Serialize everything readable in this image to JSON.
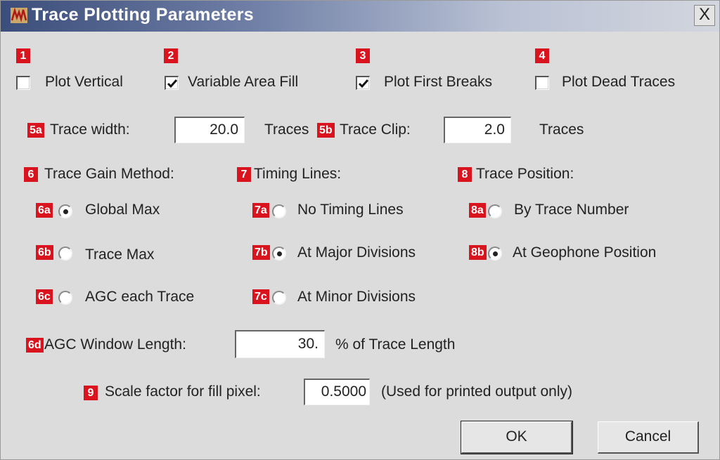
{
  "window": {
    "title": "Trace Plotting Parameters",
    "close_label": "X"
  },
  "checkboxes": [
    {
      "badge": "1",
      "label": "Plot Vertical",
      "checked": false
    },
    {
      "badge": "2",
      "label": "Variable Area Fill",
      "checked": true
    },
    {
      "badge": "3",
      "label": "Plot First Breaks",
      "checked": true
    },
    {
      "badge": "4",
      "label": "Plot Dead Traces",
      "checked": false
    }
  ],
  "trace_width": {
    "badge": "5a",
    "label": "Trace width:",
    "value": "20.0",
    "unit": "Traces"
  },
  "trace_clip": {
    "badge": "5b",
    "label": "Trace Clip:",
    "value": "2.0",
    "unit": "Traces"
  },
  "gain_method": {
    "badge": "6",
    "label": "Trace Gain Method:",
    "options": [
      {
        "badge": "6a",
        "label": "Global Max",
        "selected": true
      },
      {
        "badge": "6b",
        "label": "Trace Max",
        "selected": false
      },
      {
        "badge": "6c",
        "label": "AGC each Trace",
        "selected": false
      }
    ]
  },
  "timing_lines": {
    "badge": "7",
    "label": "Timing Lines:",
    "options": [
      {
        "badge": "7a",
        "label": "No Timing Lines",
        "selected": false
      },
      {
        "badge": "7b",
        "label": "At Major Divisions",
        "selected": true
      },
      {
        "badge": "7c",
        "label": "At Minor Divisions",
        "selected": false
      }
    ]
  },
  "trace_position": {
    "badge": "8",
    "label": "Trace Position:",
    "options": [
      {
        "badge": "8a",
        "label": "By Trace Number",
        "selected": false
      },
      {
        "badge": "8b",
        "label": "At Geophone Position",
        "selected": true
      }
    ]
  },
  "agc_window": {
    "badge": "6d",
    "label": "AGC Window Length:",
    "value": "30.",
    "unit": "% of Trace Length"
  },
  "scale_factor": {
    "badge": "9",
    "label": "Scale factor for fill pixel:",
    "value": "0.5000",
    "note": "(Used for printed output only)"
  },
  "buttons": {
    "ok": "OK",
    "cancel": "Cancel"
  },
  "colors": {
    "badge": "#d9141e",
    "title_gradient_start": "#3b4d7a",
    "dialog_bg": "#dcdcdc"
  }
}
